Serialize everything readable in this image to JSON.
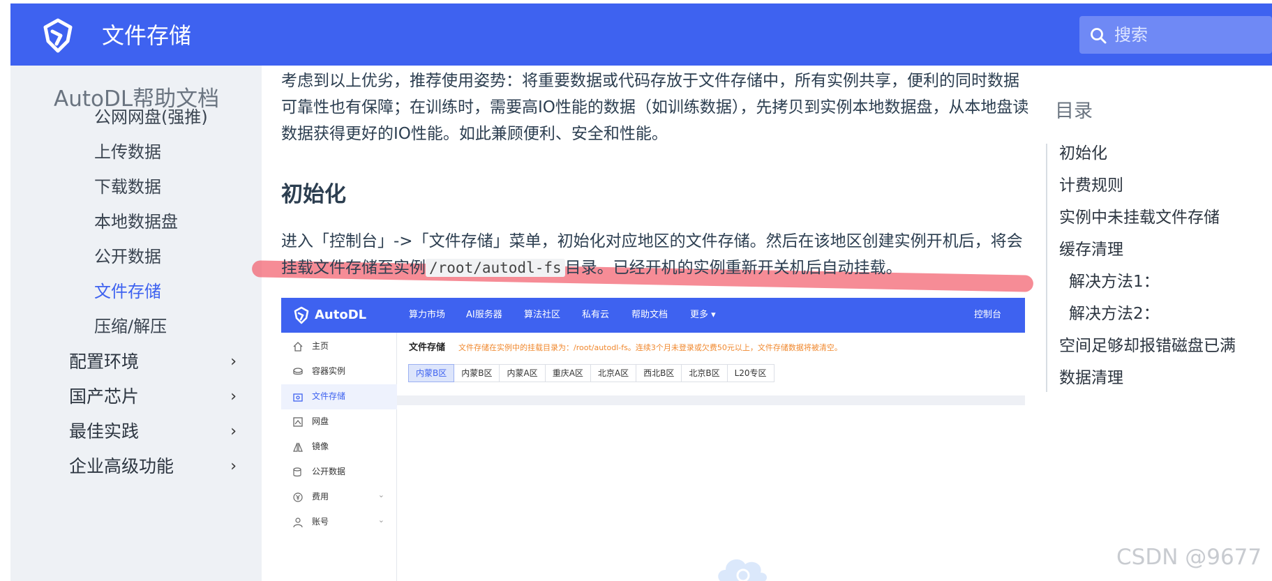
{
  "header": {
    "title": "文件存储",
    "search_placeholder": "搜索"
  },
  "sidebar": {
    "heading": "AutoDL帮助文档",
    "links": [
      {
        "label": "公网网盘(强推)"
      },
      {
        "label": "上传数据"
      },
      {
        "label": "下载数据"
      },
      {
        "label": "本地数据盘"
      },
      {
        "label": "公开数据"
      },
      {
        "label": "文件存储",
        "active": true
      },
      {
        "label": "压缩/解压"
      }
    ],
    "groups": [
      {
        "label": "配置环境"
      },
      {
        "label": "国产芯片"
      },
      {
        "label": "最佳实践"
      },
      {
        "label": "企业高级功能"
      }
    ]
  },
  "content": {
    "intro": "考虑到以上优劣，推荐使用姿势：将重要数据或代码存放于文件存储中，所有实例共享，便利的同时数据可靠性也有保障；在训练时，需要高IO性能的数据（如训练数据），先拷贝到实例本地数据盘，从本地盘读数据获得更好的IO性能。如此兼顾便利、安全和性能。",
    "init_heading": "初始化",
    "init_text_before": "进入「控制台」->「文件存储」菜单，初始化对应地区的文件存储。然后在该地区创建实例开机后，将会挂载文件存储至实例",
    "init_code": "/root/autodl-fs",
    "init_text_after": "目录。已经开机的实例重新开关机后自动挂载。"
  },
  "screenshot": {
    "brand": "AutoDL",
    "nav": [
      "算力市场",
      "AI服务器",
      "算法社区",
      "私有云",
      "帮助文档",
      "更多 ▾",
      "控制台"
    ],
    "side": [
      {
        "label": "主页",
        "icon": "home-icon"
      },
      {
        "label": "容器实例",
        "icon": "container-icon"
      },
      {
        "label": "文件存储",
        "icon": "storage-icon",
        "active": true
      },
      {
        "label": "网盘",
        "icon": "netdisk-icon"
      },
      {
        "label": "镜像",
        "icon": "mirror-icon"
      },
      {
        "label": "公开数据",
        "icon": "database-icon"
      },
      {
        "label": "费用",
        "icon": "yen-icon",
        "expand": true
      },
      {
        "label": "账号",
        "icon": "user-icon",
        "expand": true
      }
    ],
    "title": "文件存储",
    "notice": "文件存储在实例中的挂载目录为：/root/autodl-fs。连续3个月未登录或欠费50元以上，文件存储数据将被清空。",
    "regions": [
      "内蒙B区",
      "内蒙B区",
      "内蒙A区",
      "重庆A区",
      "北京A区",
      "西北B区",
      "北京B区",
      "L20专区"
    ]
  },
  "toc": {
    "heading": "目录",
    "items": [
      {
        "label": "初始化"
      },
      {
        "label": "计费规则"
      },
      {
        "label": "实例中未挂载文件存储"
      },
      {
        "label": "缓存清理"
      },
      {
        "label": "解决方法1：",
        "sub": true
      },
      {
        "label": "解决方法2：",
        "sub": true
      },
      {
        "label": "空间足够却报错磁盘已满"
      },
      {
        "label": "数据清理"
      }
    ]
  },
  "watermark": "CSDN @9677",
  "colors": {
    "brand_blue": "#3e62f0",
    "highlight_red": "#f2606d",
    "notice_orange": "#f0882e"
  }
}
